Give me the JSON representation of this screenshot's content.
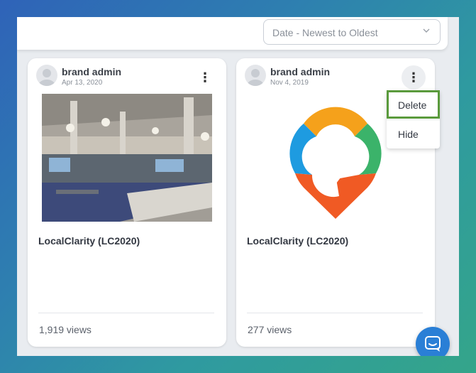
{
  "sort": {
    "selected": "Date - Newest to Oldest",
    "icon": "chevron-down-icon"
  },
  "posts": [
    {
      "author": "brand admin",
      "date": "Apr 13, 2020",
      "title": "LocalClarity (LC2020)",
      "views": "1,919 views",
      "media": "office-photo"
    },
    {
      "author": "brand admin",
      "date": "Nov 4, 2019",
      "title": "LocalClarity (LC2020)",
      "views": "277 views",
      "media": "localclarity-logo"
    }
  ],
  "menu": {
    "items": [
      {
        "label": "Delete"
      },
      {
        "label": "Hide"
      }
    ]
  },
  "colors": {
    "accent": "#2a7fd6",
    "menu_highlight": "#5a9a3c",
    "logo_orange": "#f5a11b",
    "logo_green": "#3bb36a",
    "logo_blue": "#1e9be0",
    "logo_red": "#f05a24"
  },
  "chat": {
    "icon": "chat-icon"
  }
}
